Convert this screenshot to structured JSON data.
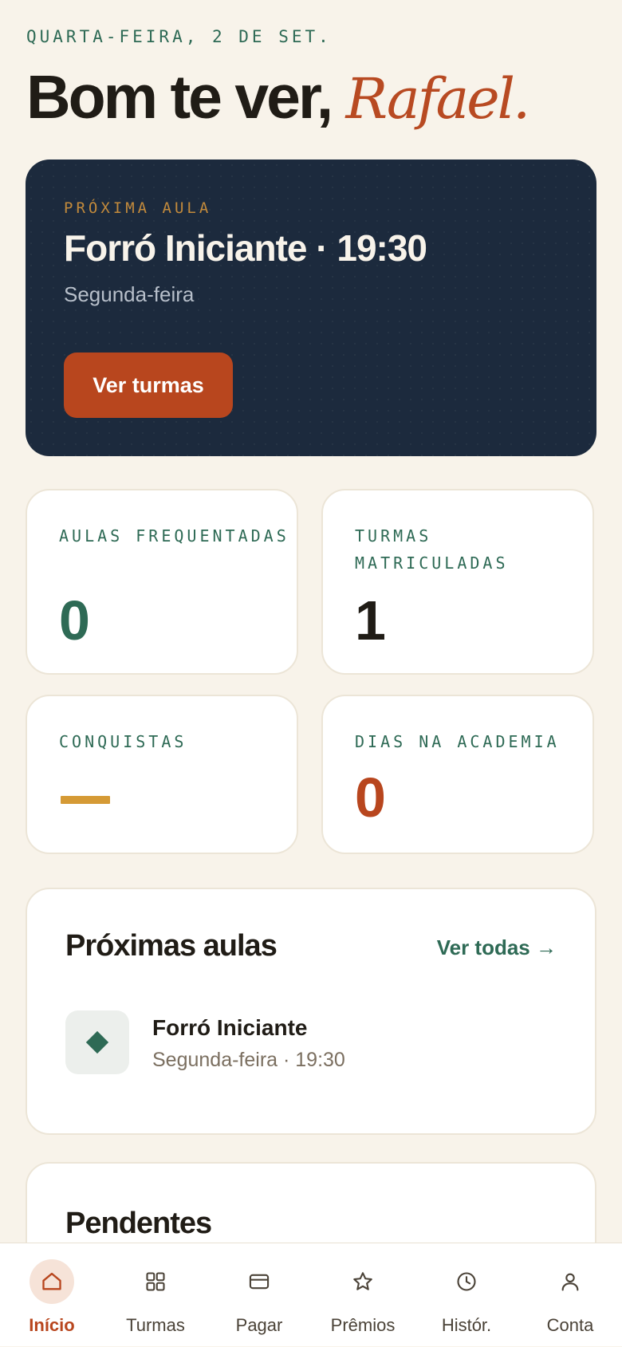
{
  "header": {
    "date": "QUARTA-FEIRA, 2 DE SET.",
    "greeting": "Bom te ver,",
    "user_name": "Rafael."
  },
  "next_class_card": {
    "label": "PRÓXIMA AULA",
    "title": "Forró Iniciante · 19:30",
    "day": "Segunda-feira",
    "button_label": "Ver turmas"
  },
  "stats": [
    {
      "label": "AULAS FREQUENTADAS",
      "value": "0",
      "color": "#2e6a55"
    },
    {
      "label": "TURMAS MATRICULADAS",
      "value": "1",
      "color": "#201c16"
    },
    {
      "label": "CONQUISTAS",
      "value": "",
      "color": "#d59a35"
    },
    {
      "label": "DIAS NA ACADEMIA",
      "value": "0",
      "color": "#b8461e"
    }
  ],
  "upcoming": {
    "title": "Próximas aulas",
    "see_all": "Ver todas →",
    "items": [
      {
        "name": "Forró Iniciante",
        "schedule": "Segunda-feira · 19:30",
        "icon": "diamond-icon"
      }
    ]
  },
  "pending": {
    "title": "Pendentes"
  },
  "tabbar": {
    "active": "Início",
    "tabs": [
      {
        "label": "Início",
        "icon": "home-icon"
      },
      {
        "label": "Turmas",
        "icon": "grid-icon"
      },
      {
        "label": "Pagar",
        "icon": "card-icon"
      },
      {
        "label": "Prêmios",
        "icon": "star-icon"
      },
      {
        "label": "Histór.",
        "icon": "clock-icon"
      },
      {
        "label": "Conta",
        "icon": "user-icon"
      }
    ]
  },
  "colors": {
    "background": "#f8f3ea",
    "accent_green": "#2e6a55",
    "accent_orange": "#b8461e",
    "accent_gold": "#d59a35",
    "navy": "#1c2a3d"
  }
}
